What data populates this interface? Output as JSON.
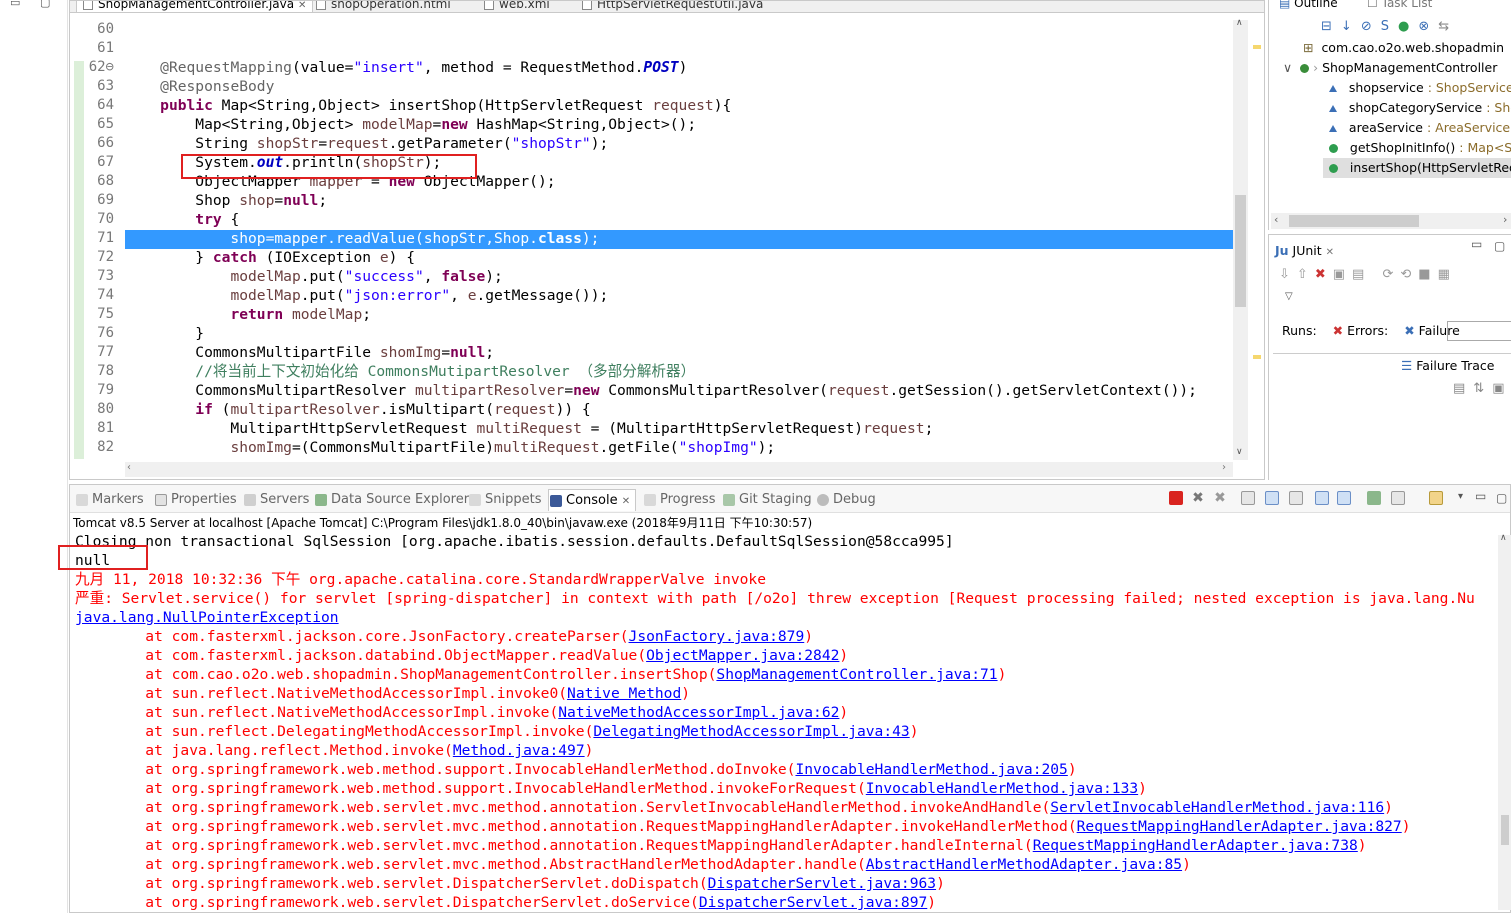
{
  "editor": {
    "tabs": [
      "ShopManagementController.java",
      "shopOperation.html",
      "web.xml",
      "HttpServletRequestUtil.java"
    ],
    "close_glyph": "✕",
    "lines": [
      {
        "n": "60",
        "html": ""
      },
      {
        "n": "61",
        "html": ""
      },
      {
        "n": "62⊖",
        "html": "    <span class=\"an\">@RequestMapping</span>(value=<span class=\"st\">\"insert\"</span>, method = RequestMethod.<span class=\"fd\">POST</span>)"
      },
      {
        "n": "63",
        "html": "    <span class=\"an\">@ResponseBody</span>"
      },
      {
        "n": "64",
        "html": "    <span class=\"kw\">public</span> Map&lt;String,Object&gt; insertShop(HttpServletRequest <span class=\"vr\">request</span>){"
      },
      {
        "n": "65",
        "html": "        Map&lt;String,Object&gt; <span class=\"vr\">modelMap</span>=<span class=\"kw\">new</span> HashMap&lt;String,Object&gt;();"
      },
      {
        "n": "66",
        "html": "        String <span class=\"vr\">shopStr</span>=<span class=\"vr\">request</span>.getParameter(<span class=\"st\">\"shopStr\"</span>);"
      },
      {
        "n": "67",
        "html": "        System.<span class=\"fd\">out</span>.println(<span class=\"vr\">shopStr</span>);"
      },
      {
        "n": "68",
        "html": "        ObjectMapper <span class=\"vr\">mapper</span> = <span class=\"kw\">new</span> ObjectMapper();"
      },
      {
        "n": "69",
        "html": "        Shop <span class=\"vr\">shop</span>=<span class=\"kw\">null</span>;"
      },
      {
        "n": "70",
        "html": "        <span class=\"kw\">try</span> {"
      },
      {
        "n": "71",
        "html": "            shop=mapper.readValue(shopStr,Shop.<b>class</b>);"
      },
      {
        "n": "72",
        "html": "        } <span class=\"kw\">catch</span> (IOException <span class=\"vr\">e</span>) {"
      },
      {
        "n": "73",
        "html": "            <span class=\"vr\">modelMap</span>.put(<span class=\"st\">\"success\"</span>, <span class=\"kw\">false</span>);"
      },
      {
        "n": "74",
        "html": "            <span class=\"vr\">modelMap</span>.put(<span class=\"st\">\"json:error\"</span>, <span class=\"vr\">e</span>.getMessage());"
      },
      {
        "n": "75",
        "html": "            <span class=\"kw\">return</span> <span class=\"vr\">modelMap</span>;"
      },
      {
        "n": "76",
        "html": "        }"
      },
      {
        "n": "77",
        "html": "        CommonsMultipartFile <span class=\"vr\">shomImg</span>=<span class=\"kw\">null</span>;"
      },
      {
        "n": "78",
        "html": "        <span class=\"cm\">//将当前上下文初始化给 CommonsMutipartResolver （多部分解析器）</span>"
      },
      {
        "n": "79",
        "html": "        CommonsMultipartResolver <span class=\"vr\">multipartResolver</span>=<span class=\"kw\">new</span> CommonsMultipartResolver(<span class=\"vr\">request</span>.getSession().getServletContext());"
      },
      {
        "n": "80",
        "html": "        <span class=\"kw\">if</span> (<span class=\"vr\">multipartResolver</span>.isMultipart(<span class=\"vr\">request</span>)) {"
      },
      {
        "n": "81",
        "html": "            MultipartHttpServletRequest <span class=\"vr\">multiRequest</span> = (MultipartHttpServletRequest)<span class=\"vr\">request</span>;"
      },
      {
        "n": "82",
        "html": "            <span class=\"vr\">shomImg</span>=(CommonsMultipartFile)<span class=\"vr\">multiRequest</span>.getFile(<span class=\"st\">\"shopImg\"</span>);"
      }
    ]
  },
  "outline": {
    "tabs": [
      "Outline",
      "Task List"
    ],
    "package": "com.cao.o2o.web.shopadmin",
    "class": "ShopManagementController",
    "items": [
      {
        "name": "shopservice",
        "type": " : ShopService"
      },
      {
        "name": "shopCategoryService",
        "type": " : Shop"
      },
      {
        "name": "areaService",
        "type": " : AreaService"
      },
      {
        "name": "getShopInitInfo()",
        "type": " : Map<St"
      },
      {
        "name": "insertShop(HttpServletRequ",
        "type": ""
      }
    ]
  },
  "junit": {
    "title": "JUnit",
    "runs_label": "Runs:",
    "errors_label": "Errors:",
    "failures_label": "Failure",
    "failure_trace": "Failure Trace"
  },
  "console": {
    "tabs": [
      "Markers",
      "Properties",
      "Servers",
      "Data Source Explorer",
      "Snippets",
      "Console",
      "Progress",
      "Git Staging",
      "Debug"
    ],
    "active_tab": "Console",
    "description": "Tomcat v8.5 Server at localhost [Apache Tomcat] C:\\Program Files\\jdk1.8.0_40\\bin\\javaw.exe (2018年9月11日 下午10:30:57)",
    "lines": [
      {
        "text": "Closing non transactional SqlSession [org.apache.ibatis.session.defaults.DefaultSqlSession@58cca995]",
        "cls": ""
      },
      {
        "text": "null",
        "cls": ""
      },
      {
        "text": "九月 11, 2018 10:32:36 下午 org.apache.catalina.core.StandardWrapperValve invoke",
        "cls": "err"
      },
      {
        "text": "严重: Servlet.service() for servlet [spring-dispatcher] in context with path [/o2o] threw exception [Request processing failed; nested exception is java.lang.Nu",
        "cls": "err"
      },
      {
        "text": "java.lang.NullPointerException",
        "cls": "lnk"
      }
    ],
    "frames": [
      {
        "at": "com.fasterxml.jackson.core.JsonFactory.createParser",
        "src": "JsonFactory.java:879"
      },
      {
        "at": "com.fasterxml.jackson.databind.ObjectMapper.readValue",
        "src": "ObjectMapper.java:2842"
      },
      {
        "at": "com.cao.o2o.web.shopadmin.ShopManagementController.insertShop",
        "src": "ShopManagementController.java:71"
      },
      {
        "at": "sun.reflect.NativeMethodAccessorImpl.invoke0",
        "src": "Native Method"
      },
      {
        "at": "sun.reflect.NativeMethodAccessorImpl.invoke",
        "src": "NativeMethodAccessorImpl.java:62"
      },
      {
        "at": "sun.reflect.DelegatingMethodAccessorImpl.invoke",
        "src": "DelegatingMethodAccessorImpl.java:43"
      },
      {
        "at": "java.lang.reflect.Method.invoke",
        "src": "Method.java:497"
      },
      {
        "at": "org.springframework.web.method.support.InvocableHandlerMethod.doInvoke",
        "src": "InvocableHandlerMethod.java:205"
      },
      {
        "at": "org.springframework.web.method.support.InvocableHandlerMethod.invokeForRequest",
        "src": "InvocableHandlerMethod.java:133"
      },
      {
        "at": "org.springframework.web.servlet.mvc.method.annotation.ServletInvocableHandlerMethod.invokeAndHandle",
        "src": "ServletInvocableHandlerMethod.java:116"
      },
      {
        "at": "org.springframework.web.servlet.mvc.method.annotation.RequestMappingHandlerAdapter.invokeHandlerMethod",
        "src": "RequestMappingHandlerAdapter.java:827"
      },
      {
        "at": "org.springframework.web.servlet.mvc.method.annotation.RequestMappingHandlerAdapter.handleInternal",
        "src": "RequestMappingHandlerAdapter.java:738"
      },
      {
        "at": "org.springframework.web.servlet.mvc.method.AbstractHandlerMethodAdapter.handle",
        "src": "AbstractHandlerMethodAdapter.java:85"
      },
      {
        "at": "org.springframework.web.servlet.DispatcherServlet.doDispatch",
        "src": "DispatcherServlet.java:963"
      },
      {
        "at": "org.springframework.web.servlet.DispatcherServlet.doService",
        "src": "DispatcherServlet.java:897"
      }
    ],
    "frame_prefix": "at "
  },
  "colors": {
    "keyword": "#7f0055",
    "string": "#2a00ff",
    "error": "#ff0000",
    "link": "#0000ff",
    "selection": "#3399ff",
    "annotation_box": "#e02020"
  }
}
